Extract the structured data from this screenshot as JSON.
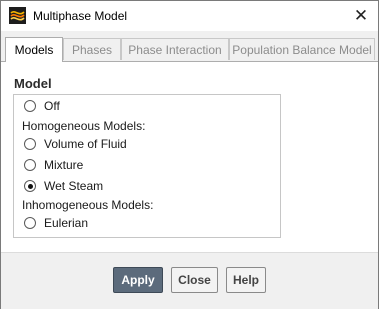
{
  "window": {
    "title": "Multiphase Model",
    "close_glyph": "✕"
  },
  "tabs": [
    {
      "label": "Models",
      "active": true
    },
    {
      "label": "Phases",
      "active": false
    },
    {
      "label": "Phase Interaction",
      "active": false
    },
    {
      "label": "Population Balance Model",
      "active": false
    }
  ],
  "model": {
    "group_label": "Model",
    "options": {
      "off": {
        "label": "Off",
        "checked": false
      },
      "homogeneous_header": "Homogeneous Models:",
      "vof": {
        "label": "Volume of Fluid",
        "checked": false
      },
      "mixture": {
        "label": "Mixture",
        "checked": false
      },
      "wet_steam": {
        "label": "Wet Steam",
        "checked": true
      },
      "inhomogeneous_header": "Inhomogeneous Models:",
      "eulerian": {
        "label": "Eulerian",
        "checked": false
      }
    }
  },
  "buttons": {
    "apply": "Apply",
    "close": "Close",
    "help": "Help"
  },
  "colors": {
    "primary_button": "#5c6b7c",
    "panel_bg": "#ffffff",
    "chrome_bg": "#f0f0f0"
  },
  "icons": {
    "app": "multiphase-app-icon",
    "close": "close-icon"
  }
}
